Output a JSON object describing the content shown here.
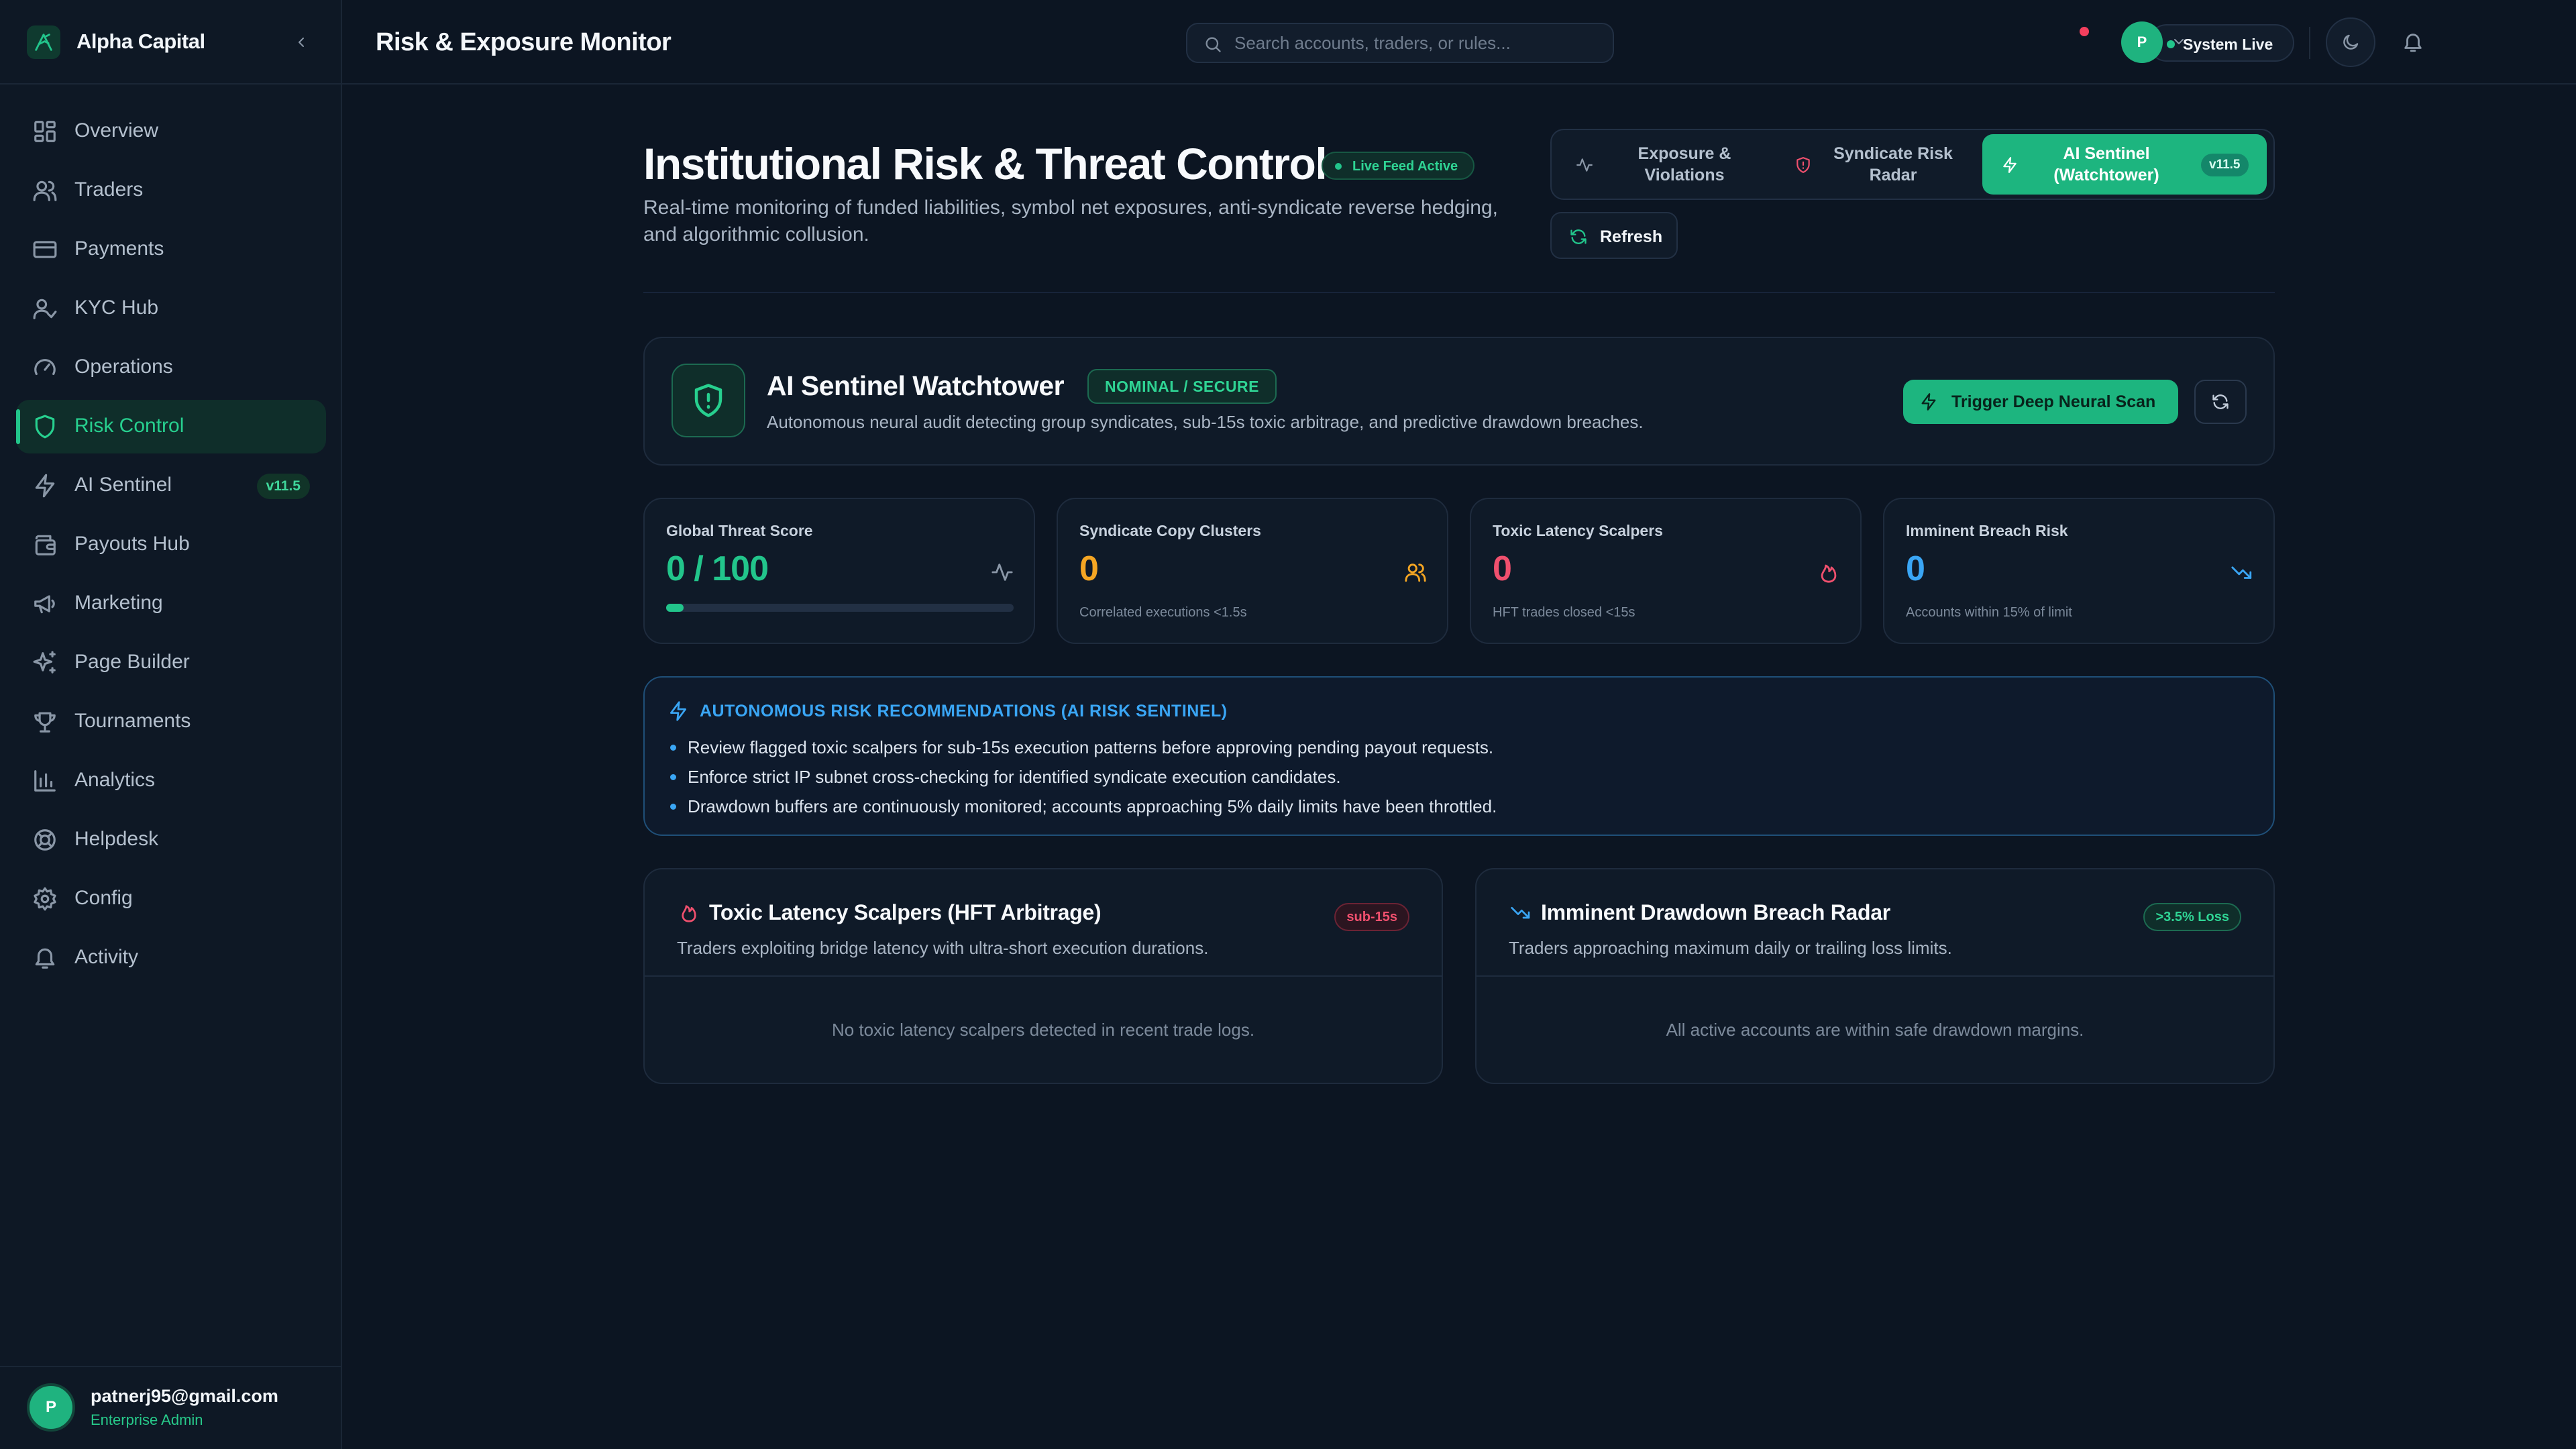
{
  "app": {
    "brand": "Alpha Capital",
    "page_title": "Risk & Exposure Monitor"
  },
  "sidebar": {
    "items": [
      {
        "label": "Overview",
        "icon": "grid-icon"
      },
      {
        "label": "Traders",
        "icon": "users-icon"
      },
      {
        "label": "Payments",
        "icon": "credit-card-icon"
      },
      {
        "label": "KYC Hub",
        "icon": "user-check-icon"
      },
      {
        "label": "Operations",
        "icon": "gauge-icon"
      },
      {
        "label": "Risk Control",
        "icon": "shield-icon",
        "active": true
      },
      {
        "label": "AI Sentinel",
        "icon": "bolt-icon",
        "badge": "v11.5"
      },
      {
        "label": "Payouts Hub",
        "icon": "wallet-icon"
      },
      {
        "label": "Marketing",
        "icon": "megaphone-icon"
      },
      {
        "label": "Page Builder",
        "icon": "sparkles-icon"
      },
      {
        "label": "Tournaments",
        "icon": "trophy-icon"
      },
      {
        "label": "Analytics",
        "icon": "bar-chart-icon"
      },
      {
        "label": "Helpdesk",
        "icon": "lifebuoy-icon"
      },
      {
        "label": "Config",
        "icon": "gear-icon"
      },
      {
        "label": "Activity",
        "icon": "bell-icon"
      }
    ],
    "user": {
      "initial": "P",
      "email": "patnerj95@gmail.com",
      "role": "Enterprise Admin"
    }
  },
  "topbar": {
    "search_placeholder": "Search accounts, traders, or rules...",
    "status": "System Live",
    "avatar_initial": "P"
  },
  "header": {
    "title": "Institutional Risk & Threat Control",
    "live_badge": "Live Feed Active",
    "subtitle": "Real-time monitoring of funded liabilities, symbol net exposures, anti-syndicate reverse hedging, and algorithmic collusion.",
    "tabs": [
      {
        "label": "Exposure & Violations"
      },
      {
        "label": "Syndicate Risk Radar"
      },
      {
        "label": "AI Sentinel (Watchtower)",
        "badge": "v11.5",
        "active": true
      }
    ],
    "refresh_label": "Refresh"
  },
  "watchtower": {
    "title": "AI Sentinel Watchtower",
    "status": "NOMINAL / SECURE",
    "description": "Autonomous neural audit detecting group syndicates, sub-15s toxic arbitrage, and predictive drawdown breaches.",
    "scan_label": "Trigger Deep Neural Scan"
  },
  "stats": [
    {
      "label": "Global Threat Score",
      "value": "0 / 100",
      "threat_fraction": 0.05,
      "color": "#22c58b"
    },
    {
      "label": "Syndicate Copy Clusters",
      "value": "0",
      "note": "Correlated executions <1.5s",
      "color": "#f5a623"
    },
    {
      "label": "Toxic Latency Scalpers",
      "value": "0",
      "note": "HFT trades closed <15s",
      "color": "#f0506e"
    },
    {
      "label": "Imminent Breach Risk",
      "value": "0",
      "note": "Accounts within 15% of limit",
      "color": "#3aa6f5"
    }
  ],
  "recommendations": {
    "title": "AUTONOMOUS RISK RECOMMENDATIONS (AI RISK SENTINEL)",
    "items": [
      "Review flagged toxic scalpers for sub-15s execution patterns before approving pending payout requests.",
      "Enforce strict IP subnet cross-checking for identified syndicate execution candidates.",
      "Drawdown buffers are continuously monitored; accounts approaching 5% daily limits have been throttled."
    ]
  },
  "panels": [
    {
      "title": "Toxic Latency Scalpers (HFT Arbitrage)",
      "badge": "sub-15s",
      "subtitle": "Traders exploiting bridge latency with ultra-short execution durations.",
      "empty": "No toxic latency scalpers detected in recent trade logs."
    },
    {
      "title": "Imminent Drawdown Breach Radar",
      "badge": ">3.5% Loss",
      "subtitle": "Traders approaching maximum daily or trailing loss limits.",
      "empty": "All active accounts are within safe drawdown margins."
    }
  ]
}
